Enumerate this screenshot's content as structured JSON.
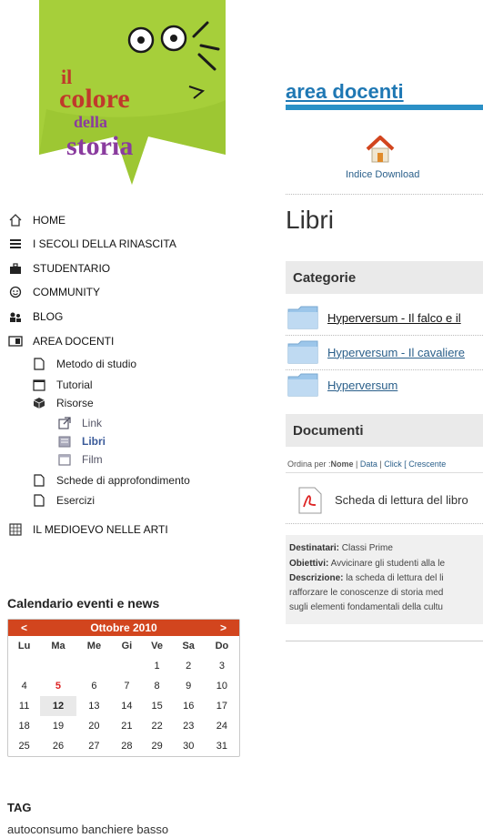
{
  "logo": {
    "line1": "il",
    "line2": "colore",
    "line3": "della",
    "line4": "storia"
  },
  "nav": {
    "items": [
      {
        "label": "HOME",
        "icon": "home-icon"
      },
      {
        "label": "I SECOLI DELLA RINASCITA",
        "icon": "menu-lines-icon"
      },
      {
        "label": "STUDENTARIO",
        "icon": "briefcase-icon"
      },
      {
        "label": "COMMUNITY",
        "icon": "smiley-icon"
      },
      {
        "label": "BLOG",
        "icon": "people-icon"
      },
      {
        "label": "AREA DOCENTI",
        "icon": "docenti-icon"
      }
    ],
    "sub": [
      {
        "label": "Metodo di studio",
        "icon": "page-icon"
      },
      {
        "label": "Tutorial",
        "icon": "window-icon"
      },
      {
        "label": "Risorse",
        "icon": "box-icon"
      }
    ],
    "risorse": [
      {
        "label": "Link",
        "icon": "external-link-icon"
      },
      {
        "label": "Libri",
        "icon": "book-icon"
      },
      {
        "label": "Film",
        "icon": "film-icon"
      }
    ],
    "sub_after": [
      {
        "label": "Schede di approfondimento",
        "icon": "page-icon"
      },
      {
        "label": "Esercizi",
        "icon": "page-icon"
      }
    ],
    "medioevo": {
      "label": "IL MEDIOEVO NELLE ARTI",
      "icon": "calendar-grid-icon"
    }
  },
  "calendar": {
    "title": "Calendario eventi e news",
    "prev": "<",
    "next": ">",
    "month": "Ottobre 2010",
    "weekdays": [
      "Lu",
      "Ma",
      "Me",
      "Gi",
      "Ve",
      "Sa",
      "Do"
    ],
    "weeks": [
      [
        "",
        "",
        "",
        "",
        "1",
        "2",
        "3"
      ],
      [
        "4",
        "5",
        "6",
        "7",
        "8",
        "9",
        "10"
      ],
      [
        "11",
        "12",
        "13",
        "14",
        "15",
        "16",
        "17"
      ],
      [
        "18",
        "19",
        "20",
        "21",
        "22",
        "23",
        "24"
      ],
      [
        "25",
        "26",
        "27",
        "28",
        "29",
        "30",
        "31"
      ]
    ],
    "highlight_red": "5",
    "today": "12"
  },
  "tags": {
    "title": "TAG",
    "text": "autoconsumo  banchiere  basso"
  },
  "main": {
    "area_title": "area docenti",
    "download_label": "Indice Download",
    "page_title": "Libri",
    "categorie_title": "Categorie",
    "categories": [
      "Hyperversum - Il falco e il",
      "Hyperversum - Il cavaliere",
      "Hyperversum"
    ],
    "documenti_title": "Documenti",
    "order": {
      "prefix": "Ordina per : ",
      "nome": "Nome",
      "data": "Data",
      "click": "Click",
      "crescente": "[ Crescente"
    },
    "doc_title": "Scheda di lettura del libro",
    "destinatari_label": "Destinatari:",
    "destinatari_value": "Classi Prime",
    "obiettivi_label": "Obiettivi:",
    "obiettivi_value": "Avvicinare gli studenti alla le",
    "descrizione_label": "Descrizione:",
    "descrizione_value": "la scheda di lettura del li",
    "descrizione_line2": "rafforzare le conoscenze di storia med",
    "descrizione_line3": "sugli elementi fondamentali della cultu"
  },
  "colors": {
    "accent_orange": "#d2451e",
    "logo_green": "#a6cf3a",
    "link_blue": "#2a5f8a",
    "title_blue": "#1f78b4"
  }
}
